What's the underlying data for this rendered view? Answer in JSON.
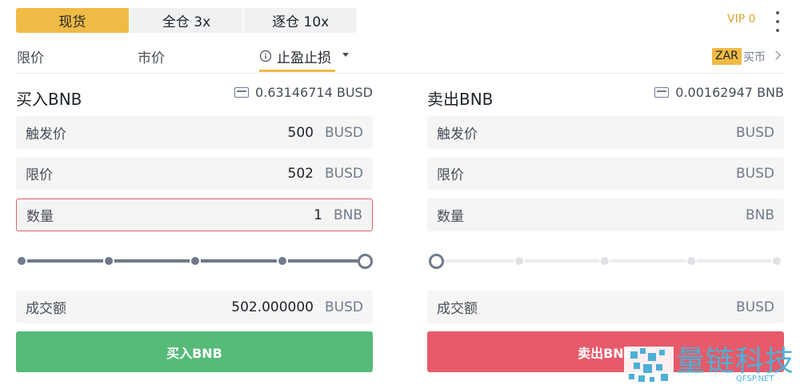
{
  "mode_tabs": [
    {
      "label": "现货"
    },
    {
      "label": "全仓 3x"
    },
    {
      "label": "逐仓 10x"
    }
  ],
  "vip": "VIP 0",
  "order_tabs": [
    {
      "label": "限价"
    },
    {
      "label": "市价"
    },
    {
      "label": "止盈止损"
    }
  ],
  "buy_crypto": {
    "currency": "ZAR",
    "label": "买币"
  },
  "buy": {
    "title": "买入BNB",
    "balance": "0.63146714 BUSD",
    "trigger": {
      "label": "触发价",
      "value": "500",
      "unit": "BUSD"
    },
    "limit": {
      "label": "限价",
      "value": "502",
      "unit": "BUSD"
    },
    "amount": {
      "label": "数量",
      "value": "1",
      "unit": "BNB"
    },
    "slider_fraction": 1.0,
    "total": {
      "label": "成交额",
      "value": "502.000000",
      "unit": "BUSD"
    },
    "button": "买入BNB"
  },
  "sell": {
    "title": "卖出BNB",
    "balance": "0.00162947 BNB",
    "trigger": {
      "label": "触发价",
      "value": "",
      "unit": "BUSD"
    },
    "limit": {
      "label": "限价",
      "value": "",
      "unit": "BUSD"
    },
    "amount": {
      "label": "数量",
      "value": "",
      "unit": "BNB"
    },
    "slider_fraction": 0.0,
    "total": {
      "label": "成交额",
      "value": "",
      "unit": "BUSD"
    },
    "button": "卖出BNB"
  },
  "watermark": {
    "title": "量链科技",
    "url": "QFSP.NET"
  },
  "colors": {
    "accent": "#f0bb45",
    "buy": "#56bb79",
    "sell": "#e75a69",
    "error_border": "#e0606a"
  }
}
